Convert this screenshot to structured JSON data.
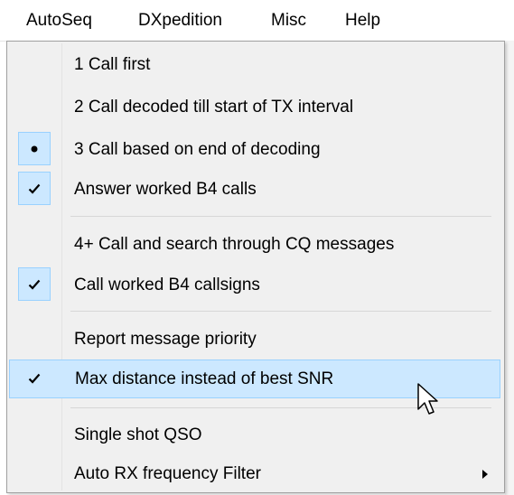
{
  "menubar": {
    "items": [
      {
        "label": "AutoSeq"
      },
      {
        "label": "DXpedition"
      },
      {
        "label": "Misc"
      },
      {
        "label": "Help"
      }
    ]
  },
  "autoseq_menu": {
    "items": [
      {
        "label": "1  Call first",
        "state": "none"
      },
      {
        "label": "2  Call decoded till start of TX interval",
        "state": "none"
      },
      {
        "label": "3  Call based on end of decoding",
        "state": "radio-selected",
        "icon": "radio-dot-icon"
      },
      {
        "label": "Answer worked B4 calls",
        "state": "checked",
        "icon": "checkmark-icon"
      },
      {
        "label": "4+ Call and search through CQ messages",
        "state": "none"
      },
      {
        "label": "Call worked B4 callsigns",
        "state": "checked",
        "icon": "checkmark-icon"
      },
      {
        "label": "Report message priority",
        "state": "none"
      },
      {
        "label": "Max distance instead of best SNR",
        "state": "checked",
        "icon": "checkmark-icon",
        "highlighted": true
      },
      {
        "label": "Single shot QSO",
        "state": "none"
      },
      {
        "label": "Auto RX frequency Filter",
        "state": "none",
        "has_submenu": true,
        "icon": "submenu-arrow-icon"
      }
    ]
  },
  "colors": {
    "menu_background": "#f0f0f0",
    "highlight_background": "#cce8ff",
    "highlight_border": "#99d1ff"
  }
}
